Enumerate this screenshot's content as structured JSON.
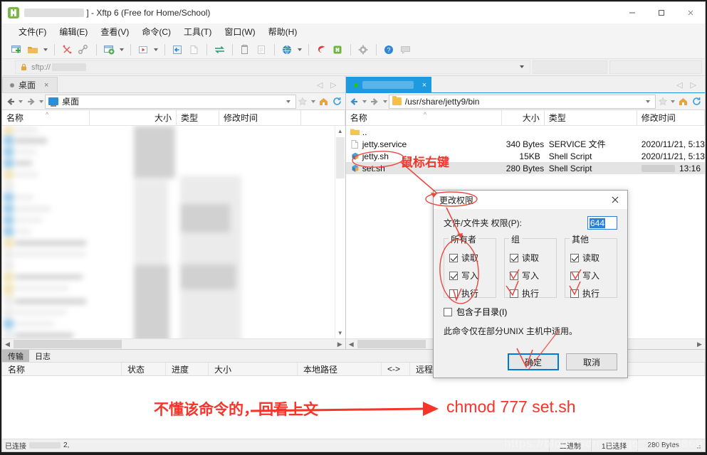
{
  "window": {
    "title_suffix": "] - Xftp 6 (Free for Home/School)",
    "app_icon": "xftp-logo-icon",
    "minimize": "minimize-icon",
    "maximize": "maximize-icon",
    "close": "close-icon"
  },
  "menubar": {
    "items": [
      {
        "label": "文件(F)"
      },
      {
        "label": "编辑(E)"
      },
      {
        "label": "查看(V)"
      },
      {
        "label": "命令(C)"
      },
      {
        "label": "工具(T)"
      },
      {
        "label": "窗口(W)"
      },
      {
        "label": "帮助(H)"
      }
    ]
  },
  "toolbar": {
    "buttons": [
      {
        "name": "new-session-icon"
      },
      {
        "name": "open-folder-icon"
      },
      {
        "name": "disconnect-icon"
      },
      {
        "name": "link-icon"
      },
      {
        "name": "new-file-transfer-icon"
      },
      {
        "name": "start-transfer-icon"
      },
      {
        "name": "sync-browse-icon"
      },
      {
        "name": "blank-page-icon"
      },
      {
        "name": "transfer-arrows-icon"
      },
      {
        "name": "copy-icon"
      },
      {
        "name": "paste-icon"
      },
      {
        "name": "globe-icon"
      },
      {
        "name": "xshell-icon"
      },
      {
        "name": "xftp-icon"
      },
      {
        "name": "settings-gear-icon"
      },
      {
        "name": "help-icon"
      },
      {
        "name": "chat-icon"
      }
    ]
  },
  "address": {
    "scheme_text": "sftp://",
    "lock_icon": "lock-icon",
    "redacted": true
  },
  "left_pane": {
    "tab": {
      "label": "桌面",
      "close": "×",
      "dot": "session-dot-icon"
    },
    "path": "桌面",
    "path_icon": "desktop-monitor-icon",
    "columns": [
      {
        "label": "名称",
        "sorted": true
      },
      {
        "label": "大小"
      },
      {
        "label": "类型"
      },
      {
        "label": "修改时间"
      }
    ],
    "rows_redacted": true
  },
  "right_pane": {
    "tab": {
      "label": "",
      "redacted": true,
      "close": "×",
      "dot": "connected-dot-icon"
    },
    "path": "/usr/share/jetty9/bin",
    "path_icon": "folder-icon",
    "columns": [
      {
        "label": "名称"
      },
      {
        "label": "大小"
      },
      {
        "label": "类型"
      },
      {
        "label": "修改时间"
      }
    ],
    "rows": [
      {
        "icon": "folder-icon",
        "name": "..",
        "size": "",
        "type": "",
        "modified": ""
      },
      {
        "icon": "file-icon",
        "name": "jetty.service",
        "size": "340 Bytes",
        "type": "SERVICE 文件",
        "modified": "2020/11/21, 5:13"
      },
      {
        "icon": "shell-script-icon",
        "name": "jetty.sh",
        "size": "15KB",
        "type": "Shell Script",
        "modified": "2020/11/21, 5:13"
      },
      {
        "icon": "shell-script-icon",
        "name": "set.sh",
        "size": "280 Bytes",
        "type": "Shell Script",
        "modified": "13:16",
        "selected": true,
        "date_redacted": true
      }
    ]
  },
  "transfer_panel": {
    "tabs": [
      {
        "label": "传输",
        "active": true
      },
      {
        "label": "日志",
        "active": false
      }
    ],
    "columns": [
      {
        "label": "名称"
      },
      {
        "label": "状态"
      },
      {
        "label": "进度"
      },
      {
        "label": "大小"
      },
      {
        "label": "本地路径"
      },
      {
        "label": "<->"
      },
      {
        "label": "远程路径"
      }
    ],
    "rows": []
  },
  "statusbar": {
    "connection_prefix": "已连接",
    "connection_suffix": "2,",
    "mode": "二进制",
    "selection": "1已选择",
    "size": "280 Bytes"
  },
  "dialog": {
    "title": "更改权限",
    "close_icon": "close-icon",
    "perm_label": "文件/文件夹 权限(P):",
    "perm_value": "644",
    "groups": [
      {
        "legend": "所有者",
        "checks": [
          {
            "label": "读取",
            "checked": true
          },
          {
            "label": "写入",
            "checked": true
          },
          {
            "label": "执行",
            "checked": false
          }
        ]
      },
      {
        "legend": "组",
        "checks": [
          {
            "label": "读取",
            "checked": true
          },
          {
            "label": "写入",
            "checked": false
          },
          {
            "label": "执行",
            "checked": false
          }
        ]
      },
      {
        "legend": "其他",
        "checks": [
          {
            "label": "读取",
            "checked": true
          },
          {
            "label": "写入",
            "checked": false
          },
          {
            "label": "执行",
            "checked": false
          }
        ]
      }
    ],
    "subdir": {
      "label": "包含子目录(I)",
      "checked": false
    },
    "note": "此命令仅在部分UNIX 主机中适用。",
    "ok_label": "确定",
    "cancel_label": "取消"
  },
  "annotations": {
    "right_click": "鼠标右键",
    "bottom_note": "不懂该命令的，回看上文",
    "bottom_command": "chmod 777 set.sh",
    "accent_color": "#f5342a"
  },
  "watermark": "https://blog.csdn.net/qq_35393869"
}
